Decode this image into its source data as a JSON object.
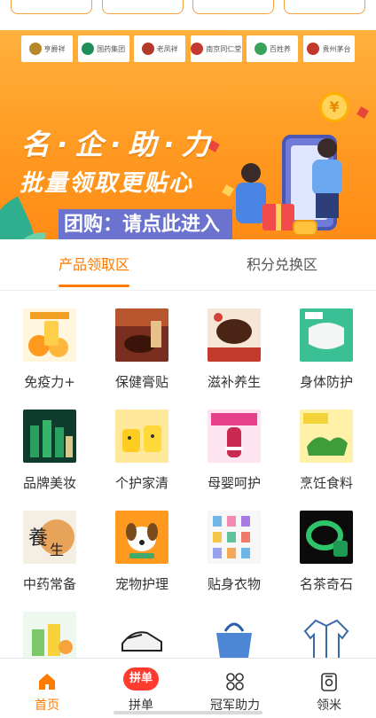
{
  "banner": {
    "logos": [
      "亨爵祥",
      "国药集团",
      "老凤祥",
      "南京同仁堂",
      "百姓养",
      "贵州茅台"
    ],
    "headline": "名·企·助·力",
    "subline": "批量领取更贴心",
    "cta": "团购：请点此进入"
  },
  "tabs": [
    {
      "label": "产品领取区",
      "active": true
    },
    {
      "label": "积分兑换区",
      "active": false
    }
  ],
  "categories": [
    {
      "label": "免疫力+",
      "icon": "vitamin-c-orange-icon"
    },
    {
      "label": "保健膏贴",
      "icon": "herbal-paste-icon"
    },
    {
      "label": "滋补养生",
      "icon": "nourishing-cake-icon"
    },
    {
      "label": "身体防护",
      "icon": "face-mask-icon"
    },
    {
      "label": "品牌美妆",
      "icon": "cosmetic-bottles-icon"
    },
    {
      "label": "个护家清",
      "icon": "yellow-cups-icon"
    },
    {
      "label": "母婴呵护",
      "icon": "baby-bottle-icon"
    },
    {
      "label": "烹饪食料",
      "icon": "green-vegetable-icon"
    },
    {
      "label": "中药常备",
      "icon": "health-calligraphy-icon"
    },
    {
      "label": "宠物护理",
      "icon": "dog-icon"
    },
    {
      "label": "贴身衣物",
      "icon": "clothing-collection-icon"
    },
    {
      "label": "名茶奇石",
      "icon": "jade-bracelet-icon"
    },
    {
      "label": "",
      "icon": "fruit-juice-icon"
    },
    {
      "label": "",
      "icon": "sneaker-icon"
    },
    {
      "label": "",
      "icon": "blue-handbag-icon"
    },
    {
      "label": "",
      "icon": "jacket-outline-icon"
    }
  ],
  "bottom_nav": [
    {
      "label": "首页",
      "icon": "home-icon",
      "active": true
    },
    {
      "label": "拼单",
      "icon": "group-buy-badge-icon",
      "active": false,
      "badge": "拼单"
    },
    {
      "label": "冠军助力",
      "icon": "grid-circles-icon",
      "active": false
    },
    {
      "label": "领米",
      "icon": "rice-bag-icon",
      "active": false
    }
  ],
  "colors": {
    "accent": "#ff7a00",
    "banner": "#ffa030",
    "cta_bg": "#6b73cf"
  }
}
